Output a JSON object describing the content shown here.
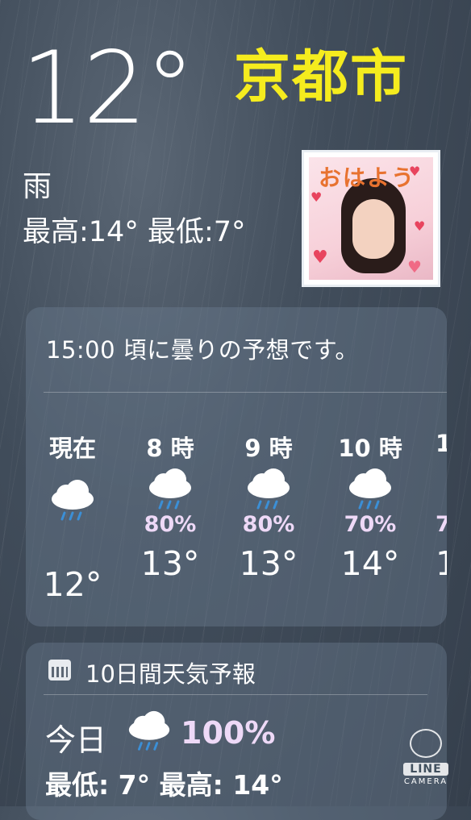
{
  "current": {
    "temperature": "12°",
    "city": "京都市",
    "condition": "雨",
    "high_low": "最高:14°  最低:7°"
  },
  "sticker": {
    "greeting": "おはよう"
  },
  "hourly": {
    "summary": "15:00 頃に曇りの予想です。",
    "items": [
      {
        "label": "現在",
        "icon": "rain-cloud-icon",
        "pct": "",
        "temp": "12°"
      },
      {
        "label": "8 時",
        "icon": "rain-cloud-icon",
        "pct": "80%",
        "temp": "13°"
      },
      {
        "label": "9 時",
        "icon": "rain-cloud-icon",
        "pct": "80%",
        "temp": "13°"
      },
      {
        "label": "10 時",
        "icon": "rain-cloud-icon",
        "pct": "70%",
        "temp": "14°"
      },
      {
        "label": "1",
        "icon": "",
        "pct": "7",
        "temp": "1"
      }
    ]
  },
  "daily": {
    "title": "10日間天気予報",
    "today_label": "今日",
    "today_pct": "100%",
    "today_hilo": "最低: 7°  最高: 14°"
  },
  "watermark": {
    "line": "LINE",
    "camera": "CAMERA"
  },
  "colors": {
    "city": "#f5ec1e",
    "precip": "#eed9f7",
    "rain_drops": "#3b8fd6"
  }
}
